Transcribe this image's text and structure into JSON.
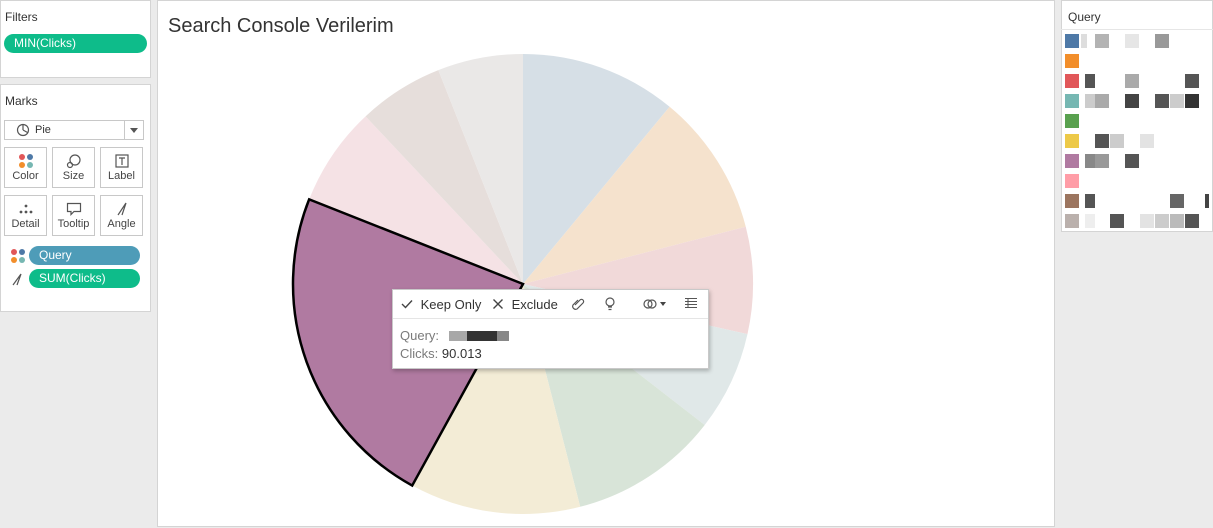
{
  "filters": {
    "title": "Filters",
    "pills": [
      {
        "label": "MIN(Clicks)"
      }
    ]
  },
  "marks": {
    "title": "Marks",
    "mark_type": "Pie",
    "buttons": [
      {
        "label": "Color",
        "icon": "color-dots-icon"
      },
      {
        "label": "Size",
        "icon": "size-icon"
      },
      {
        "label": "Label",
        "icon": "label-icon"
      },
      {
        "label": "Detail",
        "icon": "detail-dots-icon"
      },
      {
        "label": "Tooltip",
        "icon": "tooltip-icon"
      },
      {
        "label": "Angle",
        "icon": "angle-icon"
      }
    ],
    "shelf": [
      {
        "label": "Query",
        "icon": "color-dots-icon",
        "color": "#4e9cb8"
      },
      {
        "label": "SUM(Clicks)",
        "icon": "angle-icon",
        "color": "#0ebc8a"
      }
    ]
  },
  "main": {
    "title": "Search Console Verilerim"
  },
  "legend": {
    "title": "Query",
    "colors": [
      "#4e79a7",
      "#f28e2b",
      "#e15759",
      "#76b7b2",
      "#59a14f",
      "#edc948",
      "#b07aa1",
      "#ff9da7",
      "#9c755f",
      "#bab0ac"
    ]
  },
  "tooltip": {
    "actions": {
      "keep_only": "Keep Only",
      "exclude": "Exclude"
    },
    "query_label": "Query:",
    "clicks_label": "Clicks:",
    "clicks_value": "90.013"
  },
  "chart_data": {
    "type": "pie",
    "title": "Search Console Verilerim",
    "selected_index": 6,
    "slices": [
      {
        "value": 11.0,
        "color": "#d6dfe6"
      },
      {
        "value": 10.0,
        "color": "#f5e2cd"
      },
      {
        "value": 7.5,
        "color": "#f1d9d9"
      },
      {
        "value": 7.0,
        "color": "#e0e8e8"
      },
      {
        "value": 10.5,
        "color": "#d8e4d8"
      },
      {
        "value": 12.0,
        "color": "#f3ecd6"
      },
      {
        "value": 23.0,
        "color": "#b07aa1"
      },
      {
        "value": 7.0,
        "color": "#f5e2e5"
      },
      {
        "value": 6.0,
        "color": "#e6dedb"
      },
      {
        "value": 6.0,
        "color": "#eae8e7"
      }
    ]
  }
}
